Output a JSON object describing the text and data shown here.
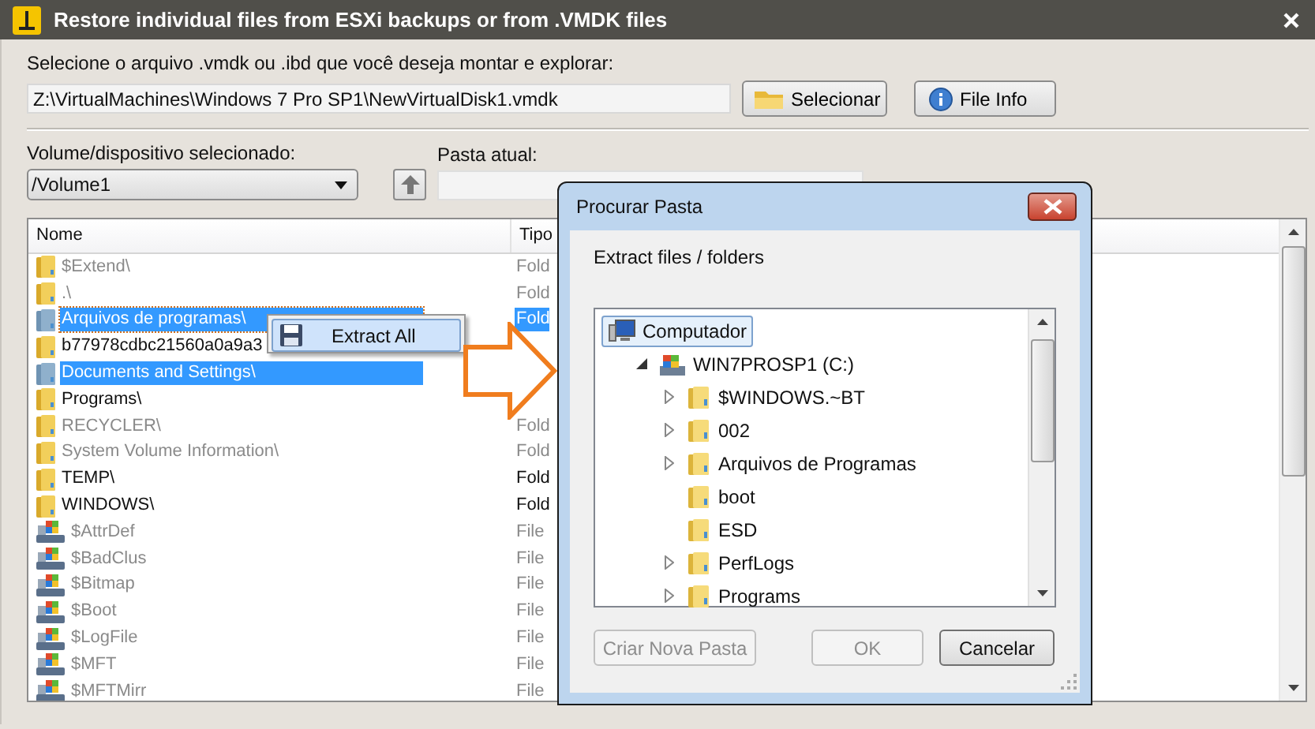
{
  "window": {
    "title": "Restore individual files from ESXi backups or from .VMDK files"
  },
  "file_section": {
    "label": "Selecione o arquivo .vmdk ou .ibd que você deseja montar e explorar:",
    "path": "Z:\\VirtualMachines\\Windows 7 Pro SP1\\NewVirtualDisk1.vmdk",
    "buttons": [
      {
        "label": "Selecionar",
        "kind": "folder"
      },
      {
        "label": "File Info",
        "kind": "info"
      }
    ]
  },
  "volume": {
    "label": "Volume/dispositivo selecionado:",
    "value": "/Volume1"
  },
  "current_folder": {
    "label": "Pasta atual:"
  },
  "table": {
    "columns": [
      "Nome",
      "Tipo"
    ],
    "rows": [
      {
        "name": "$Extend\\",
        "type": "Fold",
        "kind": "folder",
        "dimmed": true,
        "selected": false
      },
      {
        "name": ".\\",
        "type": "Fold",
        "kind": "folder",
        "dimmed": true,
        "selected": false
      },
      {
        "name": "Arquivos de programas\\",
        "type": "Fold",
        "kind": "folder",
        "dimmed": false,
        "selected": true
      },
      {
        "name": "b77978cdbc21560a0a9a3",
        "kind": "folder",
        "dimmed": false,
        "selected": false
      },
      {
        "name": "Documents and Settings\\",
        "kind": "folder",
        "dimmed": false,
        "selected": true
      },
      {
        "name": "Programs\\",
        "kind": "folder",
        "dimmed": false,
        "selected": false
      },
      {
        "name": "RECYCLER\\",
        "type": "Fold",
        "kind": "folder",
        "dimmed": true,
        "selected": false
      },
      {
        "name": "System Volume Information\\",
        "type": "Fold",
        "kind": "folder",
        "dimmed": true,
        "selected": false
      },
      {
        "name": "TEMP\\",
        "type": "Fold",
        "kind": "folder",
        "dimmed": false,
        "selected": false
      },
      {
        "name": "WINDOWS\\",
        "type": "Fold",
        "kind": "folder",
        "dimmed": false,
        "selected": false
      },
      {
        "name": "$AttrDef",
        "type": "File",
        "kind": "file",
        "dimmed": true,
        "selected": false
      },
      {
        "name": "$BadClus",
        "type": "File",
        "kind": "file",
        "dimmed": true,
        "selected": false
      },
      {
        "name": "$Bitmap",
        "type": "File",
        "kind": "file",
        "dimmed": true,
        "selected": false
      },
      {
        "name": "$Boot",
        "type": "File",
        "kind": "file",
        "dimmed": true,
        "selected": false
      },
      {
        "name": "$LogFile",
        "type": "File",
        "kind": "file",
        "dimmed": true,
        "selected": false
      },
      {
        "name": "$MFT",
        "type": "File",
        "kind": "file",
        "dimmed": true,
        "selected": false
      },
      {
        "name": "$MFTMirr",
        "type": "File",
        "kind": "file",
        "dimmed": true,
        "selected": false
      }
    ]
  },
  "context_menu": {
    "items": [
      {
        "label": "Extract All",
        "selected": true
      }
    ]
  },
  "dialog": {
    "title": "Procurar Pasta",
    "instruction": "Extract files / folders",
    "tree": [
      {
        "label": "Computador",
        "kind": "computer",
        "selected": true,
        "expandable": false,
        "children": [
          {
            "label": "WIN7PROSP1 (C:)",
            "kind": "drive",
            "selected": false,
            "expandable": true,
            "expanded": true,
            "children": [
              {
                "label": "$WINDOWS.~BT",
                "kind": "folder",
                "selected": false,
                "expandable": true,
                "expanded": false
              },
              {
                "label": "002",
                "kind": "folder",
                "selected": false,
                "expandable": true,
                "expanded": false
              },
              {
                "label": "Arquivos de Programas",
                "kind": "folder",
                "selected": false,
                "expandable": true,
                "expanded": false
              },
              {
                "label": "boot",
                "kind": "folder",
                "selected": false,
                "expandable": false
              },
              {
                "label": "ESD",
                "kind": "folder",
                "selected": false,
                "expandable": false
              },
              {
                "label": "PerfLogs",
                "kind": "folder",
                "selected": false,
                "expandable": true,
                "expanded": false
              },
              {
                "label": "Programs",
                "kind": "folder",
                "selected": false,
                "expandable": true,
                "expanded": false
              }
            ]
          }
        ]
      }
    ],
    "buttons": [
      {
        "label": "Criar Nova Pasta",
        "disabled": true
      },
      {
        "label": "OK",
        "disabled": true
      },
      {
        "label": "Cancelar",
        "disabled": false
      }
    ]
  }
}
